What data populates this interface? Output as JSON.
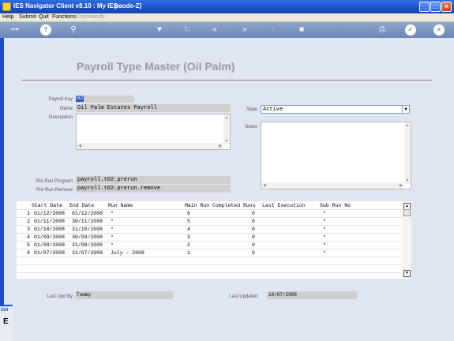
{
  "window": {
    "title": "IES Navigator Client v8.10 : My IES :",
    "mode": "[mode-Z]"
  },
  "menu": {
    "items": [
      "Help",
      "Submit",
      "Quit",
      "Functions",
      "Commands"
    ]
  },
  "toolbar": {
    "icons": [
      "key-icon",
      "help-icon",
      "search-icon",
      "heart-icon",
      "refresh-icon",
      "rewind-icon",
      "forward-icon",
      "up-icon",
      "stop-icon",
      "print-icon",
      "ok-icon",
      "close-icon"
    ]
  },
  "page": {
    "heading": "Payroll Type Master (Oil Palm)"
  },
  "form": {
    "payroll_key_label": "Payroll Key",
    "payroll_key_value": "02",
    "name_label": "Name",
    "name_value": "Oil Palm Estates Payroll",
    "description_label": "Description",
    "description_value": "",
    "state_label": "State",
    "state_value": "Active",
    "notes_label": "Notes",
    "notes_value": "",
    "pre_run_program_label": "Pre Run Program",
    "pre_run_program_value": "payroll.t02.prerun",
    "pre_run_remove_label": "Pre Run Remove",
    "pre_run_remove_value": "payroll.t02.prerun.remove"
  },
  "grid": {
    "columns": [
      "Start Date",
      "End Date",
      "Run Name",
      "Main Run",
      "Completed Runs",
      "Last Execution",
      "Sub Run No"
    ],
    "rows": [
      {
        "n": "1",
        "start": "01/12/2008",
        "end": "01/12/2008",
        "name": "*",
        "main": "6",
        "completed": "0",
        "last": "",
        "sub": "*"
      },
      {
        "n": "2",
        "start": "01/11/2008",
        "end": "30/11/2008",
        "name": "*",
        "main": "5",
        "completed": "0",
        "last": "",
        "sub": "*"
      },
      {
        "n": "3",
        "start": "01/10/2008",
        "end": "31/10/2008",
        "name": "*",
        "main": "4",
        "completed": "0",
        "last": "",
        "sub": "*"
      },
      {
        "n": "4",
        "start": "01/09/2008",
        "end": "30/09/2008",
        "name": "*",
        "main": "3",
        "completed": "0",
        "last": "",
        "sub": "*"
      },
      {
        "n": "5",
        "start": "01/08/2008",
        "end": "31/08/2008",
        "name": "*",
        "main": "2",
        "completed": "0",
        "last": "",
        "sub": "*"
      },
      {
        "n": "6",
        "start": "01/07/2008",
        "end": "31/07/2008",
        "name": "July - 2008",
        "main": "1",
        "completed": "0",
        "last": "",
        "sub": "*"
      }
    ]
  },
  "footer": {
    "last_upd_by_label": "Last Upd By",
    "last_upd_by_value": "Tommy",
    "last_updated_label": "Last Updated",
    "last_updated_value": "10/07/2008"
  },
  "side_panel": {
    "tag": "Set",
    "glyph": "E"
  },
  "colors": {
    "titlebar": "#1b4fc4",
    "toolbar": "#7c95c1",
    "background": "#dfe6f2",
    "field": "#cfcfcf",
    "heading": "#9a9a9a"
  }
}
